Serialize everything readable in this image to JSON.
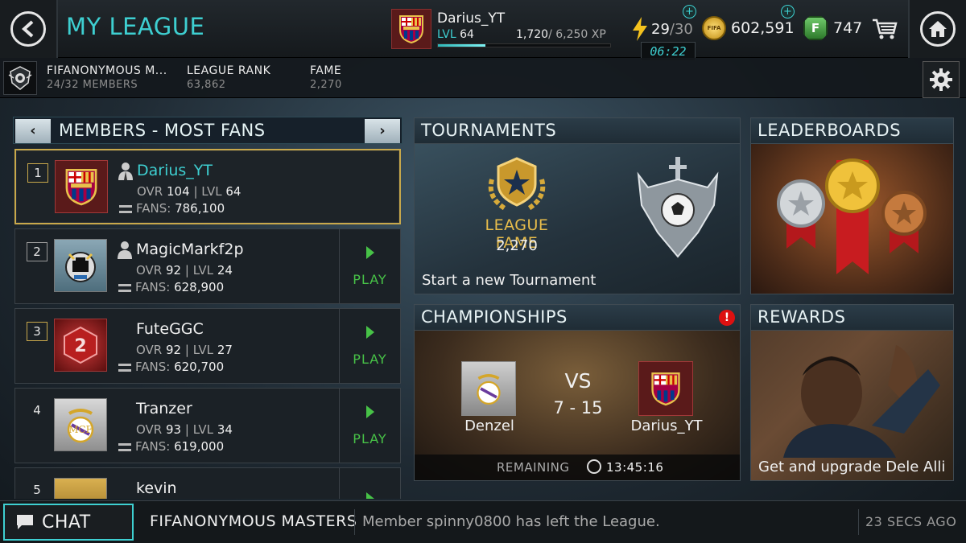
{
  "header": {
    "title": "MY LEAGUE",
    "profile": {
      "name": "Darius_YT",
      "level_label": "LVL",
      "level": "64",
      "xp_current": "1,720",
      "xp_total": "/ 6,250 XP",
      "xp_progress": 0.275
    },
    "energy": {
      "current": "29",
      "max": "/30"
    },
    "timer": "06:22",
    "coins": "602,591",
    "coin_badge": "FIFA",
    "fifa_points": "747",
    "fifa_points_badge": "F"
  },
  "league_info": {
    "name": "FIFANONYMOUS M...",
    "members": "24/32 MEMBERS",
    "rank_label": "LEAGUE RANK",
    "rank_value": "63,862",
    "fame_label": "FAME",
    "fame_value": "2,270"
  },
  "members_panel": {
    "title": "MEMBERS - MOST FANS",
    "prev_label": "‹",
    "next_label": "›",
    "play_label": "PLAY",
    "ovr_label": "OVR",
    "lvl_label": "| LVL",
    "fans_label": "FANS:",
    "rows": [
      {
        "rank": "1",
        "name": "Darius_YT",
        "ovr": "104",
        "lvl": "64",
        "fans": "786,100",
        "crest": "barcelona"
      },
      {
        "rank": "2",
        "name": "MagicMarkf2p",
        "ovr": "92",
        "lvl": "24",
        "fans": "628,900",
        "crest": "newcastle"
      },
      {
        "rank": "3",
        "name": "FuteGGC",
        "ovr": "92",
        "lvl": "27",
        "fans": "620,700",
        "crest": "red-badge",
        "crest_text": "2"
      },
      {
        "rank": "4",
        "name": "Tranzer",
        "ovr": "93",
        "lvl": "34",
        "fans": "619,000",
        "crest": "real-madrid"
      },
      {
        "rank": "5",
        "name": "kevin",
        "crest": "gold-badge"
      }
    ]
  },
  "tournaments": {
    "title": "TOURNAMENTS",
    "fame_label": "LEAGUE FAME",
    "fame_value": "2,270",
    "caption": "Start a new Tournament"
  },
  "leaderboards": {
    "title": "LEADERBOARDS"
  },
  "championships": {
    "title": "CHAMPIONSHIPS",
    "alert": "!",
    "home_team": "Denzel",
    "away_team": "Darius_YT",
    "vs": "VS",
    "score": "7 - 15",
    "remaining_label": "REMAINING",
    "remaining_time": "13:45:16"
  },
  "rewards": {
    "title": "REWARDS",
    "caption": "Get and upgrade Dele Alli"
  },
  "chat": {
    "button_label": "CHAT",
    "league_name": "FIFANONYMOUS MASTERS",
    "message": "Member spinny0800 has left the League.",
    "time": "23 SECS AGO"
  },
  "colors": {
    "accent": "#3ecfd1",
    "gold": "#e8bd4b",
    "play_green": "#47c247",
    "alert_red": "#dd1111"
  }
}
